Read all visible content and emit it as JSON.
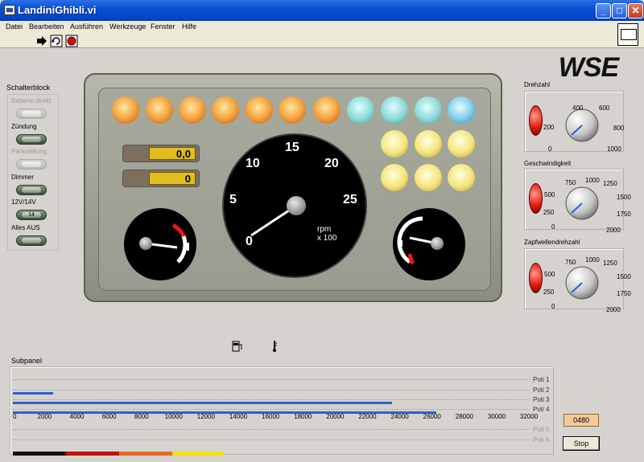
{
  "window": {
    "title": "LandiniGhibli.vi",
    "minimize_glyph": "_",
    "maximize_glyph": "□",
    "close_glyph": "✕"
  },
  "menu": {
    "items": [
      "Datei",
      "Bearbeiten",
      "Ausführen",
      "Werkzeuge",
      "Fenster",
      "Hilfe"
    ]
  },
  "toolbar": {
    "icons": [
      "run-arrow-icon",
      "run-continuously-icon",
      "abort-stop-icon"
    ]
  },
  "logo": "WSE",
  "schalterblock": {
    "title": "Schalterblock",
    "switches": [
      {
        "label": "Batterie direkt",
        "enabled": false,
        "cap": ""
      },
      {
        "label": "Zündung",
        "enabled": true,
        "cap": ""
      },
      {
        "label": "Parkstellung",
        "enabled": false,
        "cap": ""
      },
      {
        "label": "Dimmer",
        "enabled": true,
        "cap": ""
      },
      {
        "label": "12V/14V",
        "enabled": true,
        "cap": "14"
      },
      {
        "label": "Alles AUS",
        "enabled": true,
        "cap": ""
      }
    ]
  },
  "dashboard": {
    "lamps_top": [
      "orange",
      "orange",
      "orange",
      "orange",
      "orange",
      "orange",
      "orange",
      "cyan",
      "cyan",
      "cyan",
      "cyan-b"
    ],
    "lamps_right": [
      "yellow",
      "yellow",
      "yellow",
      "yellow",
      "yellow",
      "yellow"
    ],
    "display_1": "0,0",
    "display_2": "0",
    "tacho": {
      "ticks": [
        "0",
        "5",
        "10",
        "15",
        "20",
        "25"
      ],
      "unit_line1": "rpm",
      "unit_line2": "x 100",
      "value": 0
    }
  },
  "knobs": [
    {
      "title": "Drehzahl",
      "ticks": [
        "0",
        "200",
        "400",
        "600",
        "800",
        "1000"
      ]
    },
    {
      "title": "Geschwindigkeit",
      "ticks": [
        "0",
        "250",
        "500",
        "750",
        "1000",
        "1250",
        "1500",
        "1750",
        "2000"
      ]
    },
    {
      "title": "Zapfwellendrehzahl",
      "ticks": [
        "0",
        "250",
        "500",
        "750",
        "1000",
        "1250",
        "1500",
        "1750",
        "2000"
      ]
    }
  ],
  "subpanel": {
    "title": "Subpanel",
    "max": 32000,
    "sliders": [
      {
        "label": "Poti 1",
        "value": 0,
        "dim": false
      },
      {
        "label": "Poti 2",
        "value": 2500,
        "dim": false
      },
      {
        "label": "Poti 3",
        "value": 23500,
        "dim": false
      },
      {
        "label": "Poti 4",
        "value": 26200,
        "dim": false
      },
      {
        "label": "Poti 5",
        "value": 0,
        "dim": true
      },
      {
        "label": "Poti 6",
        "value": 0,
        "dim": true
      }
    ],
    "scale": [
      "0",
      "2000",
      "4000",
      "6000",
      "8000",
      "10000",
      "12000",
      "14000",
      "16000",
      "18000",
      "20000",
      "22000",
      "24000",
      "26000",
      "28000",
      "30000",
      "32000"
    ]
  },
  "status_value": "0480",
  "stop_label": "Stop",
  "colors": {
    "accent_red": "#e41b0f",
    "fill_blue": "#2d5fd3",
    "display_yellow": "#e1be20"
  }
}
